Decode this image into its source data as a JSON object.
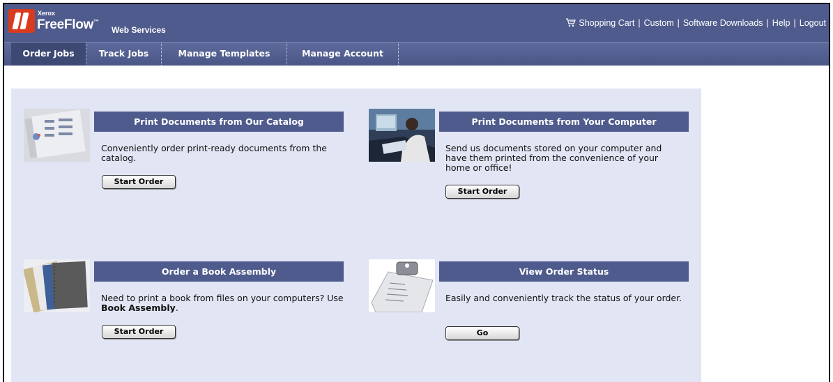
{
  "brand": {
    "company": "Xerox",
    "product": "FreeFlow",
    "tm": "™",
    "subtitle": "Web Services"
  },
  "toplinks": {
    "cart": "Shopping Cart",
    "custom": "Custom",
    "downloads": "Software Downloads",
    "help": "Help",
    "logout": "Logout",
    "separator": "|"
  },
  "nav": {
    "items": [
      {
        "label": "Order Jobs",
        "active": true
      },
      {
        "label": "Track Jobs",
        "active": false
      },
      {
        "label": "Manage Templates",
        "active": false
      },
      {
        "label": "Manage Account",
        "active": false
      }
    ]
  },
  "cards": {
    "catalog": {
      "title": "Print Documents from Our Catalog",
      "text": "Conveniently order print-ready documents from the catalog.",
      "button": "Start Order",
      "image": "printed-documents-thumbnail"
    },
    "computer": {
      "title": "Print Documents from Your Computer",
      "text": "Send us documents stored on your computer and have them printed from the convenience of your home or office!",
      "button": "Start Order",
      "image": "person-at-computer-thumbnail"
    },
    "book": {
      "title": "Order a Book Assembly",
      "text_prefix": "Need to print a book from files on your computers? Use ",
      "text_bold": "Book Assembly",
      "text_suffix": ".",
      "button": "Start Order",
      "image": "bound-books-thumbnail"
    },
    "status": {
      "title": "View Order Status",
      "text": "Easily and conveniently track the status of your order.",
      "button": "Go",
      "image": "clipboard-thumbnail"
    }
  },
  "colors": {
    "header_bg": "#4f5b8c",
    "content_bg": "#e1e5f4",
    "title_bar_bg": "#4f5b8c",
    "logo_red": "#d93b1f"
  }
}
